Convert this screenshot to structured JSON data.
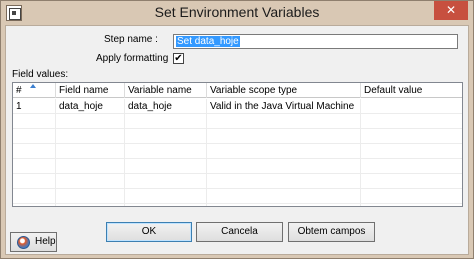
{
  "window": {
    "title": "Set Environment Variables",
    "close_glyph": "✕"
  },
  "form": {
    "step_name_label": "Step name :",
    "step_name_value": "Set data_hoje",
    "apply_formatting_label": "Apply formatting",
    "apply_formatting_checked": "✔",
    "field_values_label": "Field values:"
  },
  "table": {
    "columns": [
      "#",
      "Field name",
      "Variable name",
      "Variable scope type",
      "Default value"
    ],
    "rows": [
      [
        "1",
        "data_hoje",
        "data_hoje",
        "Valid in the Java Virtual Machine",
        ""
      ]
    ]
  },
  "buttons": {
    "ok": "OK",
    "cancel": "Cancela",
    "get_fields": "Obtem campos",
    "help": "Help"
  },
  "icons": {
    "app": "app-window-icon",
    "sort": "sort-ascending-icon",
    "help": "help-globe-icon"
  },
  "colors": {
    "close_button": "#c7503f",
    "selection": "#3399ff",
    "window_frame": "#d9c8b4"
  }
}
